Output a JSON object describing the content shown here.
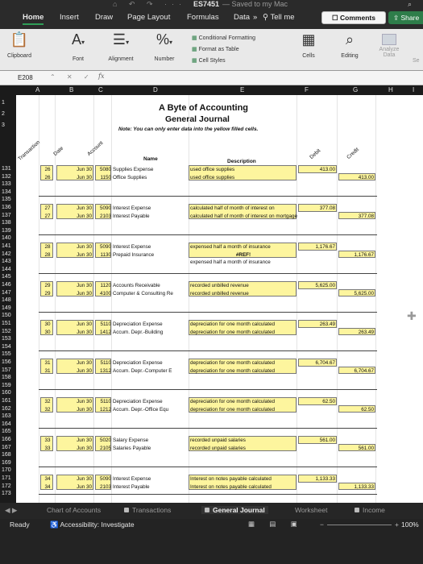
{
  "window": {
    "title": "ES7451",
    "saved": "— Saved to my Mac",
    "search_glyph": "⌕"
  },
  "tabs": [
    "Home",
    "Insert",
    "Draw",
    "Page Layout",
    "Formulas",
    "Data",
    "»",
    "Tell me"
  ],
  "comments_label": "Comments",
  "share_label": "Share",
  "ribbon": {
    "clipboard": "Clipboard",
    "font": "Font",
    "alignment": "Alignment",
    "number": "Number",
    "cond_format": "Conditional Formatting",
    "format_table": "Format as Table",
    "cell_styles": "Cell Styles",
    "cells": "Cells",
    "editing": "Editing",
    "analyze": "Analyze Data",
    "se": "Se"
  },
  "formula_bar": {
    "name_box": "E208",
    "fx": "fx",
    "content": ""
  },
  "columns": [
    "A",
    "B",
    "C",
    "D",
    "E",
    "F",
    "G",
    "H",
    "I"
  ],
  "sheet_title": "A Byte of Accounting",
  "sheet_subtitle": "General Journal",
  "note": "Note: You can only enter data into the yellow filled cells.",
  "headers": {
    "transaction": "Transaction",
    "date": "Date",
    "account": "Account",
    "name": "Name",
    "description": "Description",
    "debit": "Debit",
    "credit": "Credit"
  },
  "top_rows": [
    "1",
    "2",
    "3"
  ],
  "entries": [
    {
      "rows": [
        "131",
        "132",
        "133",
        "134",
        "135"
      ],
      "tx": "26",
      "d1": "Jun 30",
      "d2": "Jun 30",
      "a1": "5080",
      "a2": "1150",
      "n1": "Supplies Expense",
      "n2": "Office Supplies",
      "e1": "used office supplies",
      "e2": "used office supplies",
      "dr": "413.00",
      "cr": "413.00"
    },
    {
      "rows": [
        "136",
        "137",
        "138",
        "139",
        "140"
      ],
      "tx": "27",
      "d1": "Jun 30",
      "d2": "Jun 30",
      "a1": "5090",
      "a2": "2103",
      "n1": "Interest Expense",
      "n2": "Interest Payable",
      "e1": "calculated half of month of interest on",
      "e2": "calculated half of month of interest on mortgage",
      "dr": "377.08",
      "cr": "377.08"
    },
    {
      "rows": [
        "141",
        "142",
        "143",
        "144",
        "145"
      ],
      "tx": "28",
      "d1": "Jun 30",
      "d2": "Jun 30",
      "a1": "5090",
      "a2": "1130",
      "n1": "Interest Expense",
      "n2": "Prepaid Insurance",
      "e1": "expensed half a month of insurance",
      "e2": "#REF!",
      "e3": "expensed half a month of insurance",
      "dr": "1,176.67",
      "cr": "1,176.67"
    },
    {
      "rows": [
        "146",
        "147",
        "148",
        "149",
        "150"
      ],
      "tx": "29",
      "d1": "Jun 30",
      "d2": "Jun 30",
      "a1": "1120",
      "a2": "4100",
      "n1": "Accounts Receivable",
      "n2": "Computer & Consulting Re",
      "e1": "recorded unbilled revenue",
      "e2": "recorded unbilled revenue",
      "dr": "5,625.00",
      "cr": "5,625.00"
    },
    {
      "rows": [
        "151",
        "152",
        "153",
        "154",
        "155"
      ],
      "tx": "30",
      "d1": "Jun 30",
      "d2": "Jun 30",
      "a1": "5110",
      "a2": "1412",
      "n1": "Depreciation Expense",
      "n2": "Accum. Depr.-Building",
      "e1": "depreciation for one month calculated",
      "e2": "depreciation for one month calculated",
      "dr": "263.49",
      "cr": "263.49"
    },
    {
      "rows": [
        "156",
        "157",
        "158",
        "159",
        "160"
      ],
      "tx": "31",
      "d1": "Jun 30",
      "d2": "Jun 30",
      "a1": "5110",
      "a2": "1312",
      "n1": "Depreciation Expense",
      "n2": "Accum. Depr.-Computer E",
      "e1": "depreciation for one month calculated",
      "e2": "depreciation for one month calculated",
      "dr": "6,704.67",
      "cr": "6,704.67"
    },
    {
      "rows": [
        "161",
        "162",
        "163",
        "164",
        "165"
      ],
      "tx": "32",
      "d1": "Jun 30",
      "d2": "Jun 30",
      "a1": "5110",
      "a2": "1212",
      "n1": "Depreciation Expense",
      "n2": "Accum. Depr.-Office Equ",
      "e1": "depreciation for one month calculated",
      "e2": "depreciation for one month calculated",
      "dr": "62.50",
      "cr": "62.50"
    },
    {
      "rows": [
        "166",
        "167",
        "168",
        "169",
        "170"
      ],
      "tx": "33",
      "d1": "Jun 30",
      "d2": "Jun 30",
      "a1": "5020",
      "a2": "2105",
      "n1": "Salary Expense",
      "n2": "Salaries Payable",
      "e1": "recorded unpaid salaries",
      "e2": "recorded unpaid salaries",
      "dr": "561.00",
      "cr": "561.00"
    },
    {
      "rows": [
        "171",
        "172",
        "173"
      ],
      "tx": "34",
      "d1": "Jun 30",
      "d2": "Jun 30",
      "a1": "5090",
      "a2": "2103",
      "n1": "Interest Expense",
      "n2": "Interest Payable",
      "e1": "Interest on notes payable calculated",
      "e2": "Interest on notes payable calculated",
      "dr": "1,133.33",
      "cr": "1,133.33"
    }
  ],
  "sheet_tabs": [
    "Chart of Accounts",
    "Transactions",
    "General Journal",
    "Worksheet",
    "Income"
  ],
  "active_sheet": "General Journal",
  "status": {
    "ready": "Ready",
    "accessibility": "Accessibility: Investigate",
    "zoom": "100%"
  }
}
